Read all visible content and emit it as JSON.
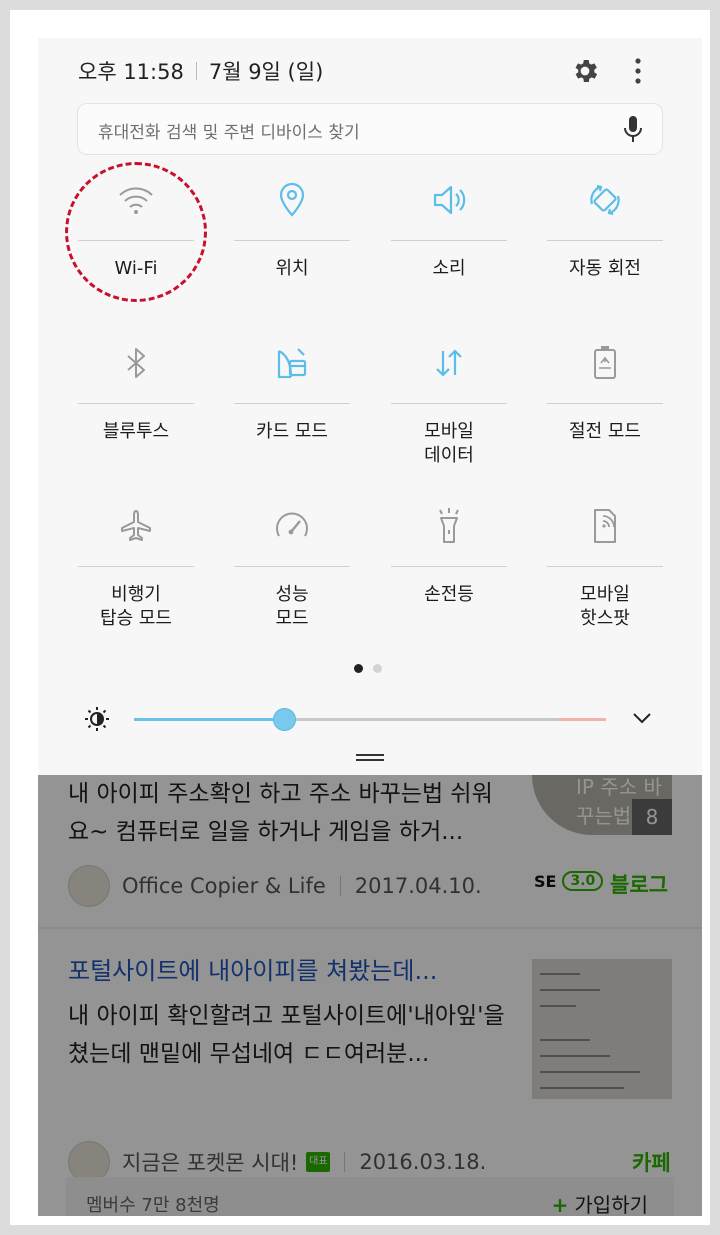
{
  "status": {
    "time": "오후 11:58",
    "date": "7월 9일 (일)"
  },
  "search": {
    "placeholder": "휴대전화 검색 및 주변 디바이스 찾기"
  },
  "tiles": [
    {
      "label": "Wi-Fi",
      "icon": "wifi-icon"
    },
    {
      "label": "위치",
      "icon": "location-icon"
    },
    {
      "label": "소리",
      "icon": "sound-icon"
    },
    {
      "label": "자동 회전",
      "icon": "auto-rotate-icon"
    },
    {
      "label": "블루투스",
      "icon": "bluetooth-icon"
    },
    {
      "label": "카드 모드",
      "icon": "card-mode-icon"
    },
    {
      "label": "모바일\n데이터",
      "icon": "mobile-data-icon"
    },
    {
      "label": "절전 모드",
      "icon": "power-saving-icon"
    },
    {
      "label": "비행기\n탑승 모드",
      "icon": "airplane-icon"
    },
    {
      "label": "성능\n모드",
      "icon": "performance-icon"
    },
    {
      "label": "손전등",
      "icon": "flashlight-icon"
    },
    {
      "label": "모바일\n핫스팟",
      "icon": "hotspot-icon"
    }
  ],
  "page_indicator": {
    "pages": 2,
    "current": 1
  },
  "brightness": {
    "level": 0.32
  },
  "colors": {
    "accent": "#5bbde9",
    "annotation": "#c8102e",
    "blog_green": "#2db400",
    "link_blue": "#2155b8"
  },
  "results": [
    {
      "text": "내 아이피 주소확인 하고 주소 바꾸는법 쉬워요~ 컴퓨터로 일을 하거나 게임을 하거...",
      "thumb_title": "IP 주소 바꾸는법",
      "thumb_count": "8",
      "author": "Office Copier & Life",
      "date": "2017.04.10.",
      "se_label": "SE",
      "se_version": "3.0",
      "source": "블로그"
    },
    {
      "title": "포털사이트에 내아이피를 쳐봤는데...",
      "text": "내 아이피 확인할려고 포털사이트에'내아잎'을 쳤는데 맨밑에 무섭네여 ㄷㄷ여러분...",
      "author": "지금은 포켓몬 시대!",
      "badge": "대표",
      "date": "2016.03.18.",
      "source": "카페",
      "members": "멤버수 7만 8천명",
      "join": "가입하기"
    }
  ]
}
